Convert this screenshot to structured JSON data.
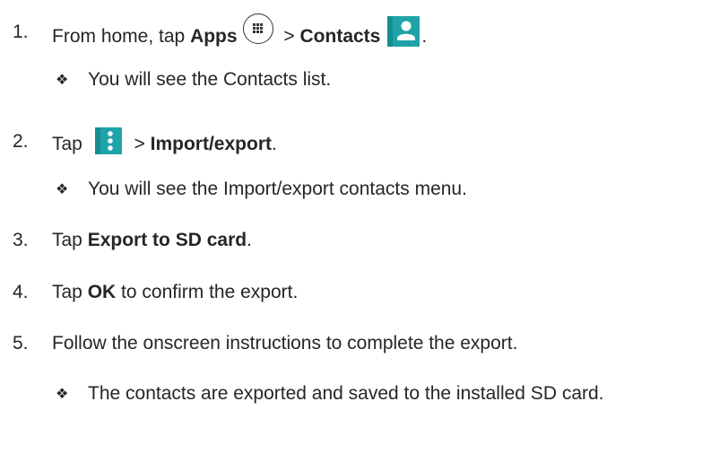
{
  "steps": [
    {
      "number": "1.",
      "text_before": "From home, tap ",
      "bold_1": "Apps",
      "sep": " > ",
      "bold_2": "Contacts",
      "text_after": ".",
      "icon_1": "apps-grid-icon",
      "icon_2": "contacts-person-icon",
      "sub": "You will see the Contacts list."
    },
    {
      "number": "2.",
      "text_before": "Tap ",
      "sep": " > ",
      "bold_1": "Import/export",
      "text_after": ".",
      "icon_1": "overflow-menu-icon",
      "sub": "You will see the Import/export contacts menu."
    },
    {
      "number": "3.",
      "text_before": "Tap ",
      "bold_1": "Export to SD card",
      "text_after": "."
    },
    {
      "number": "4.",
      "text_before": "Tap ",
      "bold_1": "OK",
      "text_after": " to confirm the export."
    },
    {
      "number": "5.",
      "text_before": "Follow the onscreen instructions to complete the export.",
      "sub": "The contacts are exported and saved to the installed SD card."
    }
  ],
  "bullet_symbol": "❖",
  "colors": {
    "text": "#262626",
    "icon_teal": "#1fa3a8",
    "icon_teal_dark": "#168e93",
    "icon_white": "#ffffff"
  }
}
